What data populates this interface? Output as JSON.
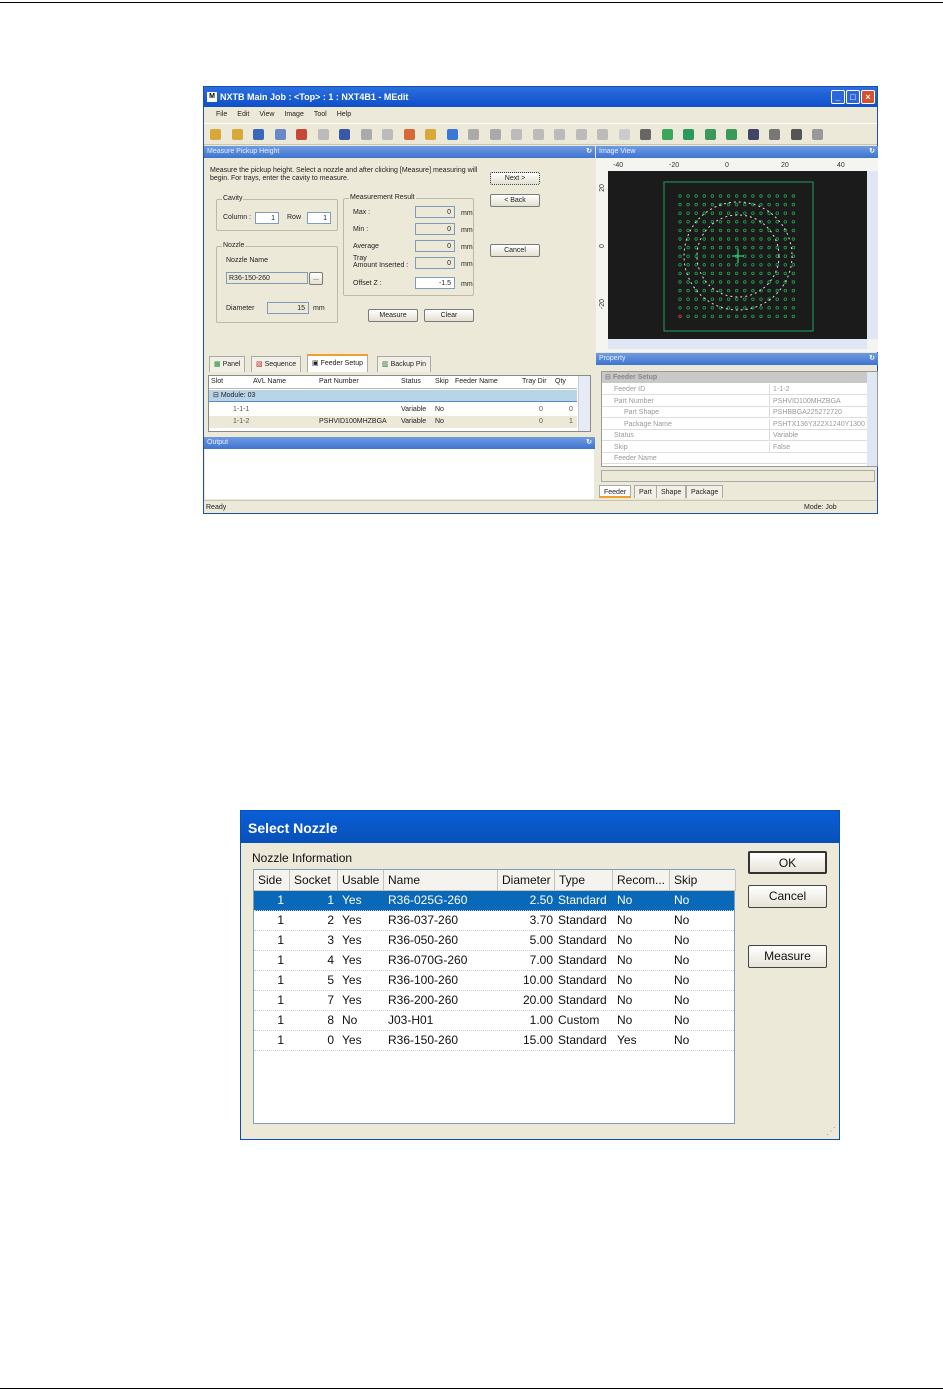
{
  "app": {
    "title": "NXTB Main Job : <Top> : 1 : NXT4B1 - MEdit",
    "menu": [
      "File",
      "Edit",
      "View",
      "Image",
      "Tool",
      "Help"
    ],
    "measure_panel": {
      "title": "Measure Pickup Height",
      "instructions": "Measure the pickup height. Select a nozzle and after clicking [Measure] measuring will begin.  For trays, enter the cavity to measure.",
      "cavity": {
        "label": "Cavity",
        "column_label": "Column :",
        "column_value": "1",
        "row_label": "Row",
        "row_value": "1"
      },
      "nozzle": {
        "label": "Nozzle",
        "name_label": "Nozzle Name",
        "name_value": "R36-150-260",
        "browse_label": "...",
        "diameter_label": "Diameter",
        "diameter_value": "15",
        "unit": "mm"
      },
      "result": {
        "label": "Measurement Result",
        "max_label": "Max :",
        "max": "0",
        "min_label": "Min :",
        "min": "0",
        "avg_label": "Average",
        "avg": "0",
        "tray_label1": "Tray",
        "tray_label2": "Amount Inserted :",
        "tray": "0",
        "offset_label": "Offset Z :",
        "offset": "-1.5",
        "unit": "mm"
      },
      "buttons": {
        "next": "Next >",
        "back": "< Back",
        "cancel": "Cancel",
        "measure": "Measure",
        "clear": "Clear"
      }
    },
    "tabs": [
      "Panel",
      "Sequence",
      "Feeder Setup",
      "Backup Pin"
    ],
    "feeder_grid": {
      "columns": [
        "Slot",
        "AVL Name",
        "Part Number",
        "Status",
        "Skip",
        "Feeder Name",
        "Tray Dir",
        "Qty"
      ],
      "group": "Module: 03",
      "rows": [
        {
          "slot": "1-1-1",
          "avl": "",
          "part": "",
          "status": "Variable",
          "skip": "No",
          "feeder": "",
          "traydir": "0",
          "qty": "0"
        },
        {
          "slot": "1-1-2",
          "avl": "",
          "part": "PSHVID100MHZBGA",
          "status": "Variable",
          "skip": "No",
          "feeder": "",
          "traydir": "0",
          "qty": "1"
        }
      ]
    },
    "output_title": "Output",
    "status": "Ready",
    "image_view": {
      "title": "Image View",
      "x_ticks": [
        "-40",
        "-20",
        "0",
        "20",
        "40"
      ],
      "y_ticks": [
        "20",
        "0",
        "-20"
      ]
    },
    "property": {
      "title": "Property",
      "category": "Feeder Setup",
      "rows": [
        {
          "name": "Feeder ID",
          "value": "1-1-2"
        },
        {
          "name": "Part Number",
          "value": "PSHVID100MHZBGA"
        },
        {
          "name": "Part Shape",
          "value": "PSHBBGA225272720"
        },
        {
          "name": "Package Name",
          "value": "PSHTX136Y322X1240Y1300"
        },
        {
          "name": "Status",
          "value": "Variable"
        },
        {
          "name": "Skip",
          "value": "False"
        },
        {
          "name": "Feeder Name",
          "value": ""
        }
      ],
      "tabs": [
        "Feeder",
        "Part",
        "Shape",
        "Package"
      ]
    },
    "mode": "Mode: Job"
  },
  "dialog": {
    "title": "Select Nozzle",
    "group_label": "Nozzle Information",
    "columns": [
      "Side",
      "Socket",
      "Usable",
      "Name",
      "Diameter",
      "Type",
      "Recom...",
      "Skip"
    ],
    "rows": [
      [
        "1",
        "1",
        "Yes",
        "R36-025G-260",
        "2.50",
        "Standard",
        "No",
        "No"
      ],
      [
        "1",
        "2",
        "Yes",
        "R36-037-260",
        "3.70",
        "Standard",
        "No",
        "No"
      ],
      [
        "1",
        "3",
        "Yes",
        "R36-050-260",
        "5.00",
        "Standard",
        "No",
        "No"
      ],
      [
        "1",
        "4",
        "Yes",
        "R36-070G-260",
        "7.00",
        "Standard",
        "No",
        "No"
      ],
      [
        "1",
        "5",
        "Yes",
        "R36-100-260",
        "10.00",
        "Standard",
        "No",
        "No"
      ],
      [
        "1",
        "7",
        "Yes",
        "R36-200-260",
        "20.00",
        "Standard",
        "No",
        "No"
      ],
      [
        "1",
        "8",
        "No",
        "J03-H01",
        "1.00",
        "Custom",
        "No",
        "No"
      ],
      [
        "1",
        "0",
        "Yes",
        "R36-150-260",
        "15.00",
        "Standard",
        "Yes",
        "No"
      ]
    ],
    "selected_row": 0,
    "buttons": {
      "ok": "OK",
      "cancel": "Cancel",
      "measure": "Measure"
    }
  }
}
